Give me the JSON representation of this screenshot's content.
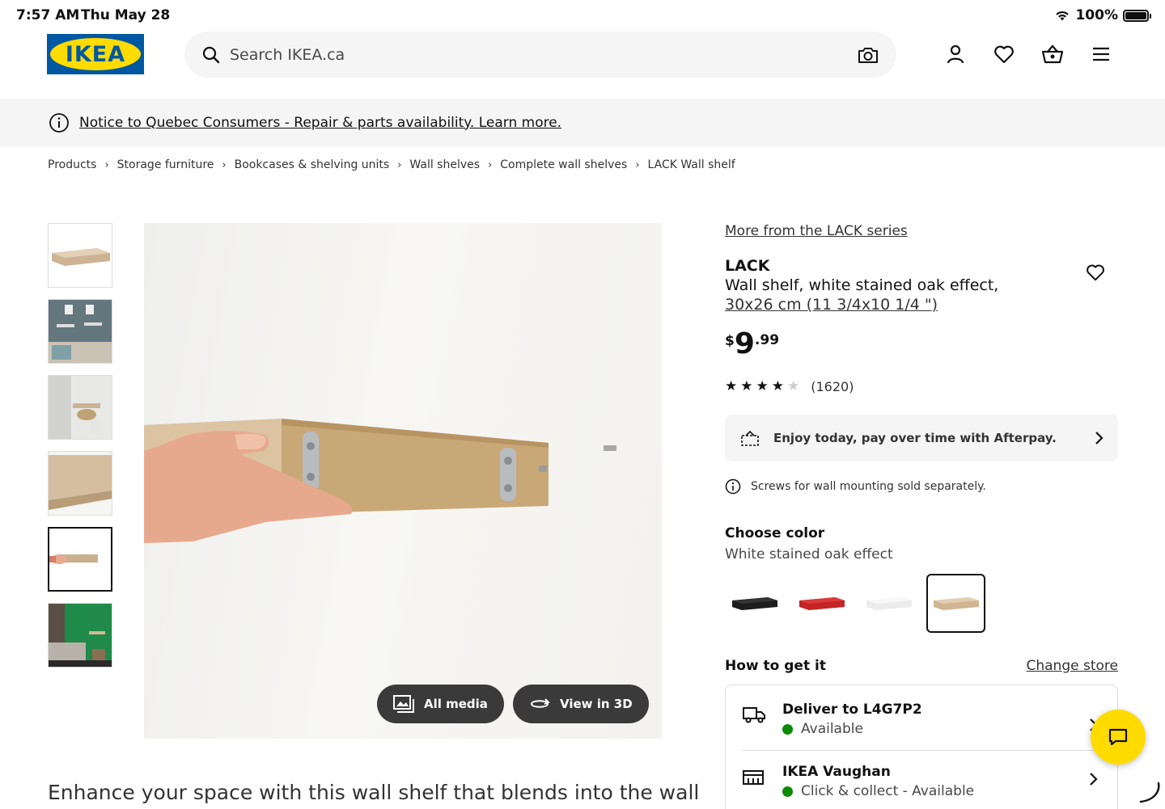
{
  "status_bar": {
    "time": "7:57 AM",
    "date": "Thu May 28",
    "battery": "100%",
    "battery_level": 1.0
  },
  "header": {
    "logo_text": "IKEA",
    "search_placeholder": "Search IKEA.ca",
    "icons": [
      "account-icon",
      "heart-icon",
      "basket-icon",
      "menu-icon"
    ]
  },
  "notice": {
    "text": "Notice to Quebec Consumers - Repair & parts availability. Learn more."
  },
  "breadcrumb": [
    "Products",
    "Storage furniture",
    "Bookcases & shelving units",
    "Wall shelves",
    "Complete wall shelves",
    "LACK Wall shelf"
  ],
  "media": {
    "all_media": "All media",
    "view_3d": "View in 3D",
    "thumbnail_count": 6,
    "selected_thumbnail": 5
  },
  "description": "Enhance your space with this wall shelf that blends into the wall",
  "product": {
    "series_link": "More from the LACK series",
    "name": "LACK",
    "description": "Wall shelf, white stained oak effect,",
    "size": "30x26 cm (11 3/4x10 1/4 \")",
    "price_currency": "$",
    "price_integer": "9",
    "price_decimal": ".99",
    "rating": 4,
    "rating_max": 5,
    "review_count": "(1620)",
    "afterpay": "Enjoy today, pay over time with Afterpay.",
    "screws_note": "Screws for wall mounting sold separately."
  },
  "color": {
    "label": "Choose color",
    "value": "White stained oak effect",
    "swatches": [
      "#222222",
      "#d22a2a",
      "#f4f4f4",
      "#d9c3a2"
    ],
    "selected_index": 3
  },
  "availability": {
    "label": "How to get it",
    "change_store": "Change store",
    "delivery_title": "Deliver to L4G7P2",
    "delivery_status": "Available",
    "store_title": "IKEA Vaughan",
    "store_status": "Click & collect - Available",
    "status_color": "#0a8a00"
  },
  "colors": {
    "brand_blue": "#0058a3",
    "brand_yellow": "#ffdb00"
  }
}
